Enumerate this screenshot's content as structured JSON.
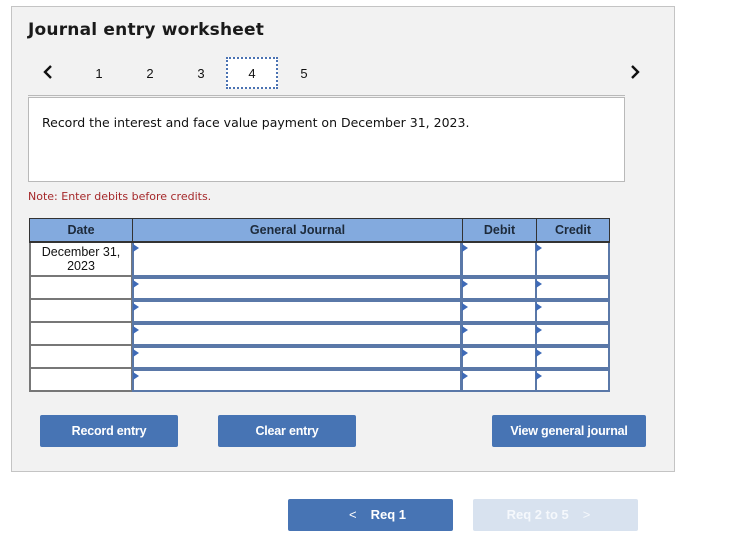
{
  "worksheet": {
    "title": "Journal entry worksheet",
    "steps": [
      "1",
      "2",
      "3",
      "4",
      "5"
    ],
    "active_step": "4",
    "prev_icon": "chevron-left-icon",
    "next_icon": "chevron-right-icon",
    "instruction": "Record the interest and face value payment on December 31, 2023.",
    "note": "Note: Enter debits before credits."
  },
  "journal": {
    "headers": {
      "date": "Date",
      "general_journal": "General Journal",
      "debit": "Debit",
      "credit": "Credit"
    },
    "rows": [
      {
        "date": "December 31, 2023",
        "account": "",
        "debit": "",
        "credit": ""
      },
      {
        "date": "",
        "account": "",
        "debit": "",
        "credit": ""
      },
      {
        "date": "",
        "account": "",
        "debit": "",
        "credit": ""
      },
      {
        "date": "",
        "account": "",
        "debit": "",
        "credit": ""
      },
      {
        "date": "",
        "account": "",
        "debit": "",
        "credit": ""
      },
      {
        "date": "",
        "account": "",
        "debit": "",
        "credit": ""
      }
    ]
  },
  "actions": {
    "record_entry": "Record entry",
    "clear_entry": "Clear entry",
    "view_general_journal": "View general journal"
  },
  "requirements_nav": {
    "prev_label": "Req 1",
    "next_label": "Req 2 to 5",
    "prev_icon": "chevron-left-icon",
    "next_icon": "chevron-right-icon",
    "next_enabled": false
  },
  "colors": {
    "accent": "#4774b4",
    "header_bg": "#83aade",
    "note": "#a5282a",
    "disabled_button": "#d8e2ef"
  }
}
